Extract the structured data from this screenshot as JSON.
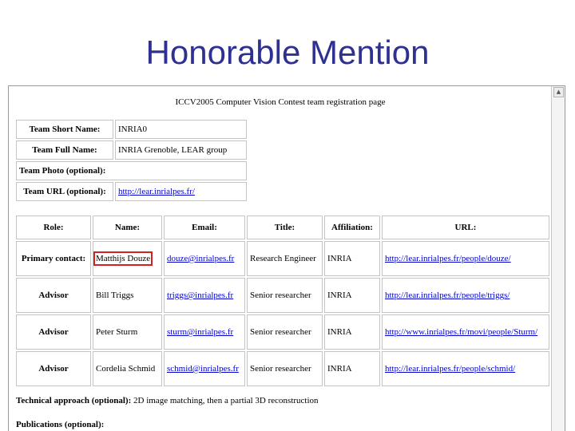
{
  "slide": {
    "title": "Honorable Mention"
  },
  "page": {
    "heading": "ICCV2005 Computer Vision Contest team registration page",
    "team": {
      "short_name_label": "Team Short Name:",
      "short_name_value": "INRIA0",
      "full_name_label": "Team Full Name:",
      "full_name_value": "INRIA Grenoble, LEAR group",
      "photo_label": "Team Photo (optional):",
      "url_label": "Team URL (optional):",
      "url_value": "http://lear.inrialpes.fr/"
    },
    "members": {
      "headers": [
        "Role:",
        "Name:",
        "Email:",
        "Title:",
        "Affiliation:",
        "URL:"
      ],
      "rows": [
        {
          "role": "Primary contact:",
          "name": "Matthijs Douze",
          "email": "douze@inrialpes.fr",
          "title": "Research Engineer",
          "affiliation": "INRIA",
          "url": "http://lear.inrialpes.fr/people/douze/"
        },
        {
          "role": "Advisor",
          "name": "Bill Triggs",
          "email": "triggs@inrialpes.fr",
          "title": "Senior researcher",
          "affiliation": "INRIA",
          "url": "http://lear.inrialpes.fr/people/triggs/"
        },
        {
          "role": "Advisor",
          "name": "Peter Sturm",
          "email": "sturm@inrialpes.fr",
          "title": "Senior researcher",
          "affiliation": "INRIA",
          "url": "http://www.inrialpes.fr/movi/people/Sturm/"
        },
        {
          "role": "Advisor",
          "name": "Cordelia Schmid",
          "email": "schmid@inrialpes.fr",
          "title": "Senior researcher",
          "affiliation": "INRIA",
          "url": "http://lear.inrialpes.fr/people/schmid/"
        }
      ]
    },
    "technical_label": "Technical approach (optional):",
    "technical_value": "2D image matching, then a partial 3D reconstruction",
    "publications_label": "Publications (optional):"
  },
  "colors": {
    "title": "#2e3192",
    "link": "#0000cc",
    "highlight": "#d42020"
  },
  "icons": {
    "scroll_up": "scroll-up-arrow-icon"
  }
}
